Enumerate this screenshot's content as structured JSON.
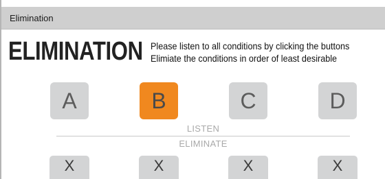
{
  "window": {
    "title": "Elimination"
  },
  "main": {
    "heading": "ELIMINATION",
    "instructions": [
      "Please listen to all conditions by clicking the buttons",
      "Elimiate the conditions in order of least desirable"
    ],
    "listen_label": "LISTEN",
    "eliminate_label": "ELIMINATE",
    "conditions": [
      {
        "label": "A",
        "selected": false
      },
      {
        "label": "B",
        "selected": true
      },
      {
        "label": "C",
        "selected": false
      },
      {
        "label": "D",
        "selected": false
      }
    ],
    "eliminate_buttons": [
      "X",
      "X",
      "X",
      "X"
    ]
  },
  "colors": {
    "selected_button": "#f0881f",
    "button": "#d3d4d5",
    "title_bar": "#cfcfcf"
  }
}
